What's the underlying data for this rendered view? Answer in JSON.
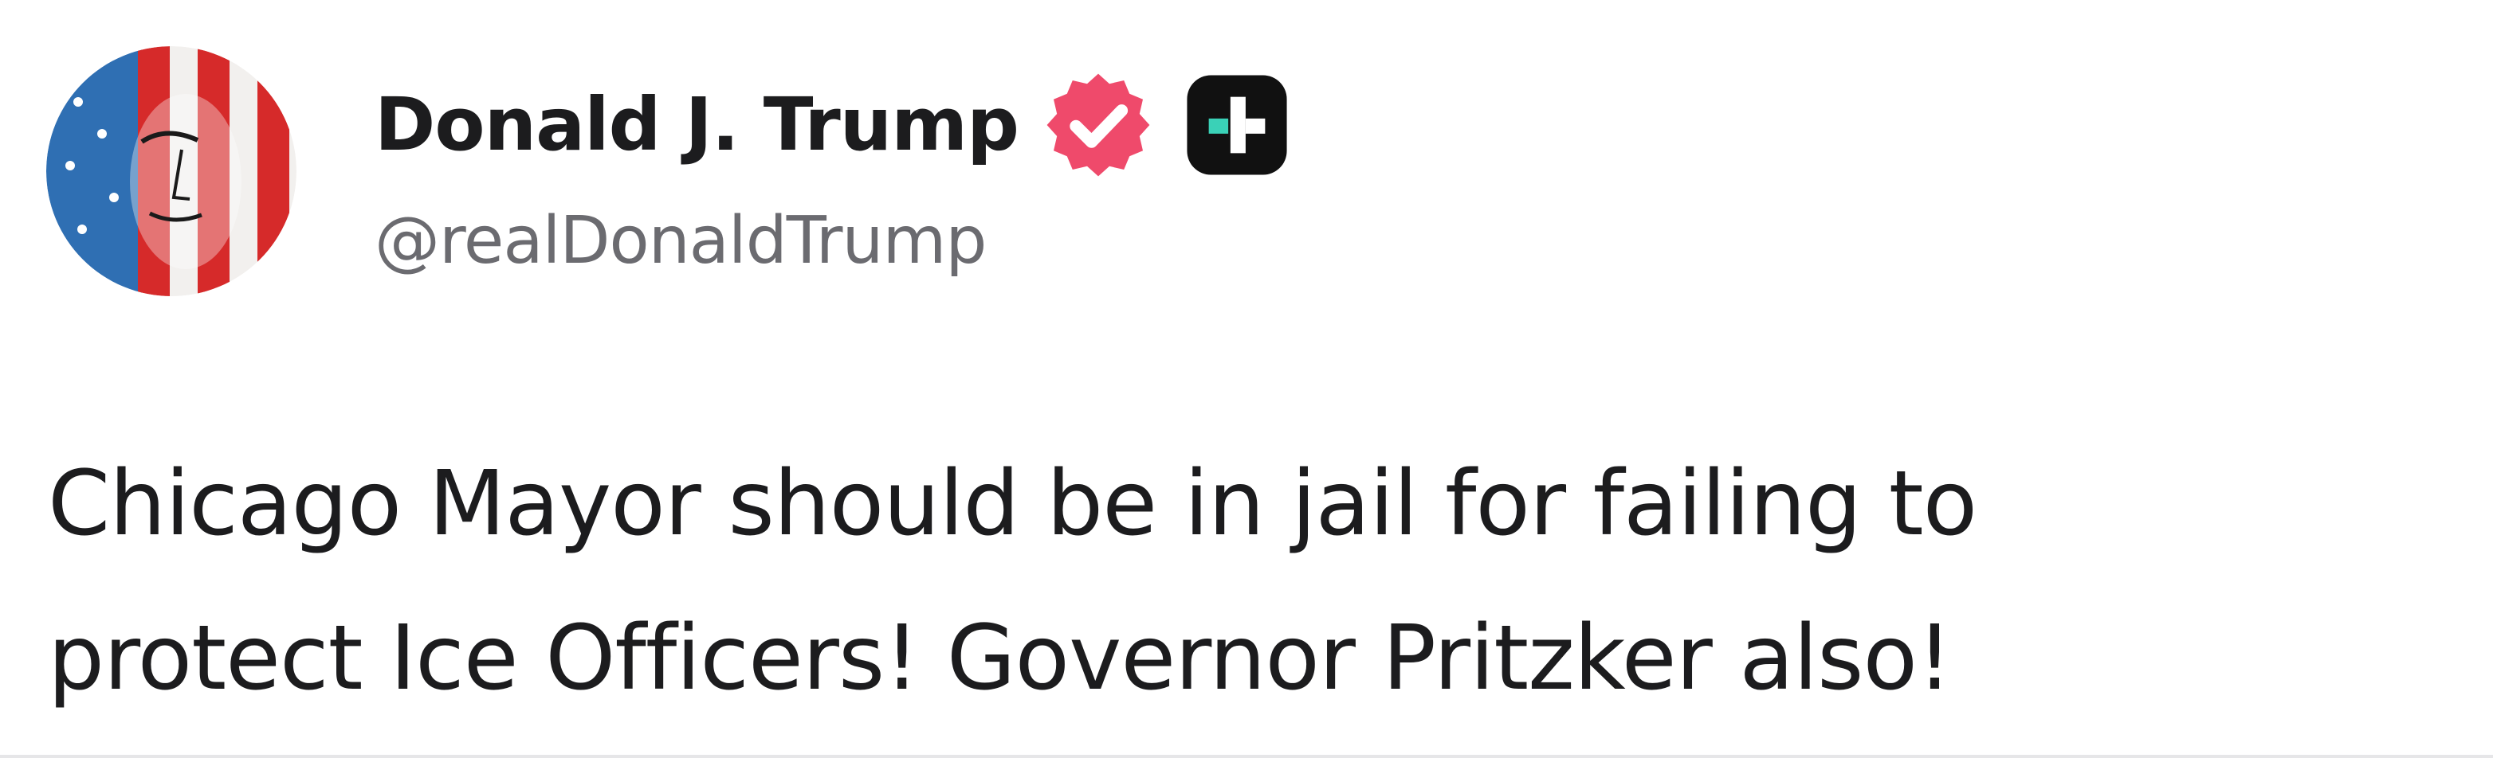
{
  "author": {
    "display_name": "Donald J. Trump",
    "handle": "@realDonaldTrump",
    "verified_badge_icon": "verified-check-icon",
    "verified_badge_color": "#ef4a6b",
    "subscriber_badge_icon": "truth-plus-icon",
    "subscriber_badge_color": "#111111",
    "subscriber_badge_accent": "#3ad1b7"
  },
  "post": {
    "lines": [
      "Chicago Mayor should be in jail for failing to",
      "protect Ice Officers! Governor Pritzker also!"
    ]
  }
}
